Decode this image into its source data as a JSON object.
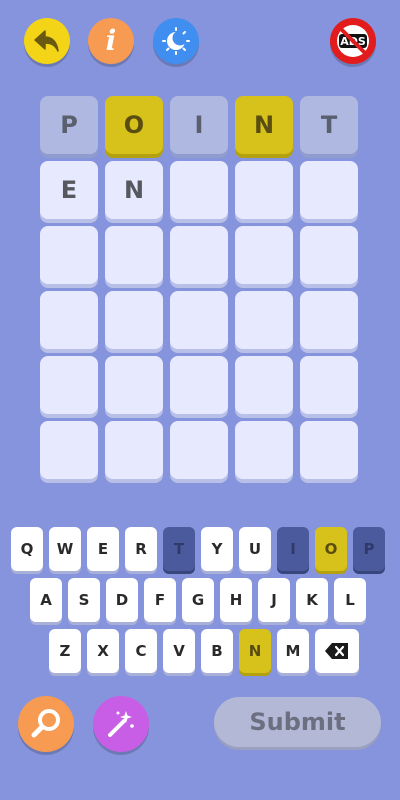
{
  "top_bar": {
    "back_icon": "back-arrow-icon",
    "info_label": "i",
    "theme_icon": "moon-sun-icon",
    "ads_label": "ADS"
  },
  "board": {
    "rows": [
      [
        {
          "letter": "P",
          "state": "absent"
        },
        {
          "letter": "O",
          "state": "present"
        },
        {
          "letter": "I",
          "state": "absent"
        },
        {
          "letter": "N",
          "state": "present"
        },
        {
          "letter": "T",
          "state": "absent"
        }
      ],
      [
        {
          "letter": "E",
          "state": "typed"
        },
        {
          "letter": "N",
          "state": "typed"
        },
        {
          "letter": "",
          "state": "empty"
        },
        {
          "letter": "",
          "state": "empty"
        },
        {
          "letter": "",
          "state": "empty"
        }
      ],
      [
        {
          "letter": "",
          "state": "empty"
        },
        {
          "letter": "",
          "state": "empty"
        },
        {
          "letter": "",
          "state": "empty"
        },
        {
          "letter": "",
          "state": "empty"
        },
        {
          "letter": "",
          "state": "empty"
        }
      ],
      [
        {
          "letter": "",
          "state": "empty"
        },
        {
          "letter": "",
          "state": "empty"
        },
        {
          "letter": "",
          "state": "empty"
        },
        {
          "letter": "",
          "state": "empty"
        },
        {
          "letter": "",
          "state": "empty"
        }
      ],
      [
        {
          "letter": "",
          "state": "empty"
        },
        {
          "letter": "",
          "state": "empty"
        },
        {
          "letter": "",
          "state": "empty"
        },
        {
          "letter": "",
          "state": "empty"
        },
        {
          "letter": "",
          "state": "empty"
        }
      ],
      [
        {
          "letter": "",
          "state": "empty"
        },
        {
          "letter": "",
          "state": "empty"
        },
        {
          "letter": "",
          "state": "empty"
        },
        {
          "letter": "",
          "state": "empty"
        },
        {
          "letter": "",
          "state": "empty"
        }
      ]
    ]
  },
  "keyboard": {
    "rows": [
      [
        {
          "label": "Q",
          "state": "unused"
        },
        {
          "label": "W",
          "state": "unused"
        },
        {
          "label": "E",
          "state": "unused"
        },
        {
          "label": "R",
          "state": "unused"
        },
        {
          "label": "T",
          "state": "absent"
        },
        {
          "label": "Y",
          "state": "unused"
        },
        {
          "label": "U",
          "state": "unused"
        },
        {
          "label": "I",
          "state": "absent"
        },
        {
          "label": "O",
          "state": "present"
        },
        {
          "label": "P",
          "state": "absent"
        }
      ],
      [
        {
          "label": "A",
          "state": "unused"
        },
        {
          "label": "S",
          "state": "unused"
        },
        {
          "label": "D",
          "state": "unused"
        },
        {
          "label": "F",
          "state": "unused"
        },
        {
          "label": "G",
          "state": "unused"
        },
        {
          "label": "H",
          "state": "unused"
        },
        {
          "label": "J",
          "state": "unused"
        },
        {
          "label": "K",
          "state": "unused"
        },
        {
          "label": "L",
          "state": "unused"
        }
      ],
      [
        {
          "label": "Z",
          "state": "unused"
        },
        {
          "label": "X",
          "state": "unused"
        },
        {
          "label": "C",
          "state": "unused"
        },
        {
          "label": "V",
          "state": "unused"
        },
        {
          "label": "B",
          "state": "unused"
        },
        {
          "label": "N",
          "state": "present"
        },
        {
          "label": "M",
          "state": "unused"
        },
        {
          "label": "",
          "state": "backspace"
        }
      ]
    ]
  },
  "bottom": {
    "search_icon": "magnifier-icon",
    "magic_icon": "magic-wand-icon",
    "submit_label": "Submit"
  },
  "colors": {
    "background": "#8594dc",
    "tile_empty": "#e7eaff",
    "tile_absent": "#aeb8e0",
    "present": "#d6c21a",
    "key_absent": "#4a5a9c"
  }
}
